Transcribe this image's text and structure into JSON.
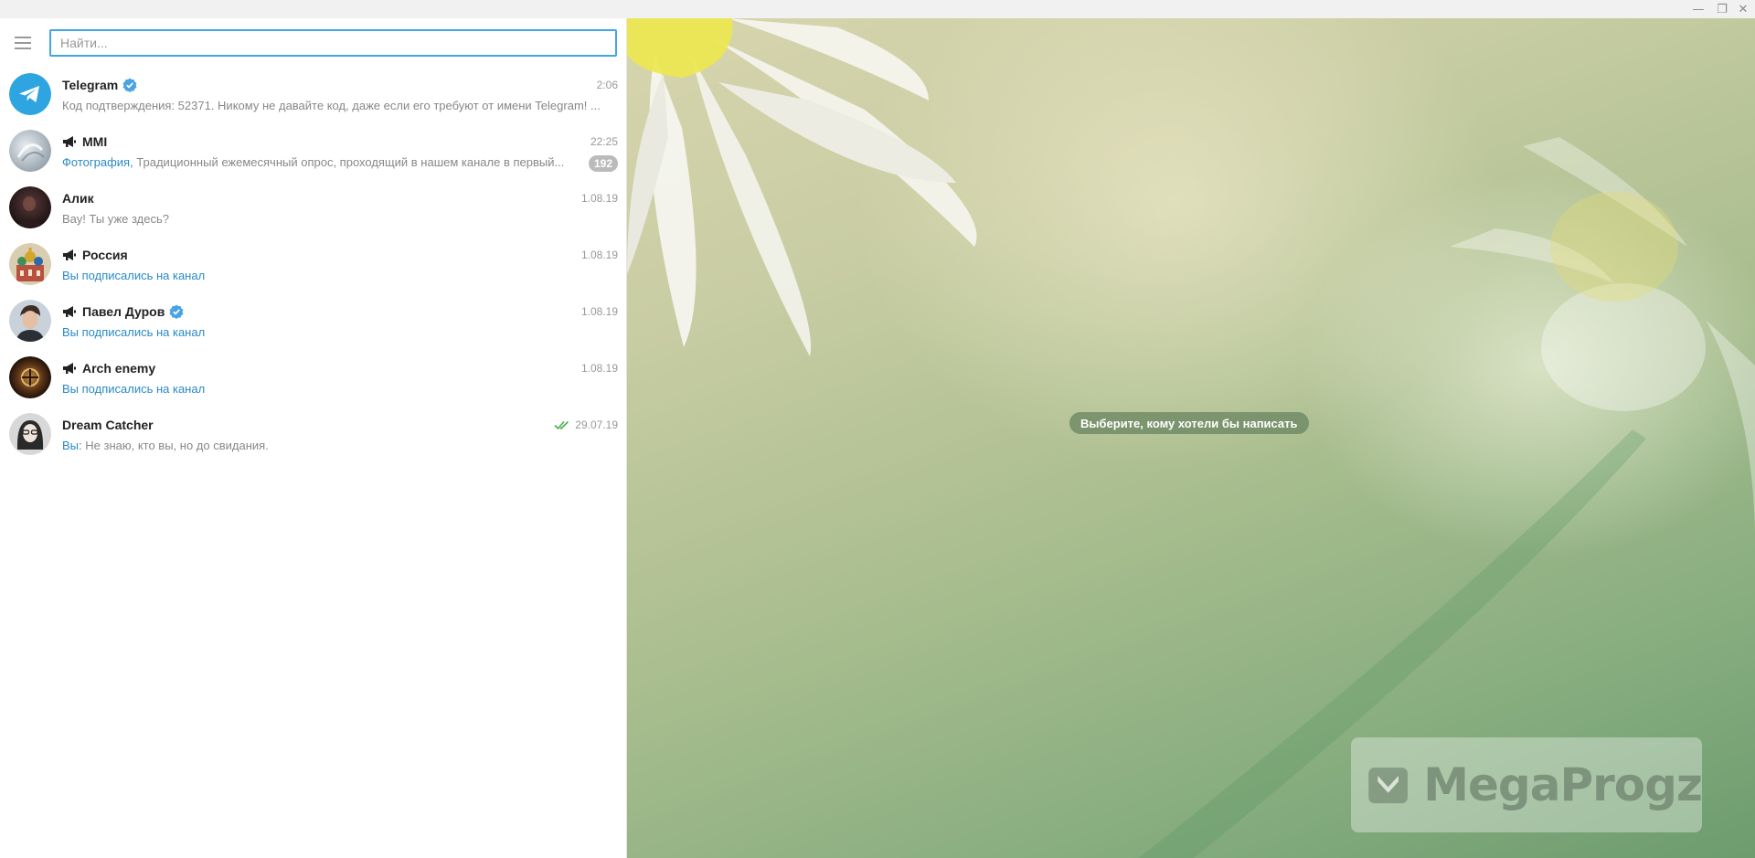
{
  "window": {
    "minimize_glyph": "—",
    "maximize_glyph": "❐",
    "close_glyph": "✕"
  },
  "search": {
    "placeholder": "Найти..."
  },
  "dialogs": [
    {
      "title": "Telegram",
      "time": "2:06",
      "text": "Код подтверждения: 52371. Никому не давайте код, даже если его требуют от имени Telegram!  ...",
      "verified": true,
      "channel": false
    },
    {
      "title": "MMI",
      "time": "22:25",
      "accent": "Фотография,",
      "text": " Традиционный ежемесячный опрос, проходящий в нашем канале в первый...",
      "badge": "192",
      "channel": true
    },
    {
      "title": "Алик",
      "time": "1.08.19",
      "text": "Вау! Ты уже здесь?",
      "channel": false
    },
    {
      "title": "Россия",
      "time": "1.08.19",
      "accent": "Вы подписались на канал",
      "channel": true
    },
    {
      "title": "Павел Дуров",
      "time": "1.08.19",
      "accent": "Вы подписались на канал",
      "verified": true,
      "channel": true
    },
    {
      "title": "Arch enemy",
      "time": "1.08.19",
      "accent": "Вы подписались на канал",
      "channel": true
    },
    {
      "title": "Dream Catcher",
      "time": "29.07.19",
      "accent": "Вы:",
      "text": " Не знаю, кто вы, но до свидания.",
      "read": true,
      "channel": false
    }
  ],
  "main": {
    "empty_text": "Выберите, кому хотели бы написать",
    "watermark": "MegaProgz"
  },
  "colors": {
    "accent": "#2a8ac6",
    "search_border": "#40a7e3",
    "read_check": "#4fae4e"
  }
}
